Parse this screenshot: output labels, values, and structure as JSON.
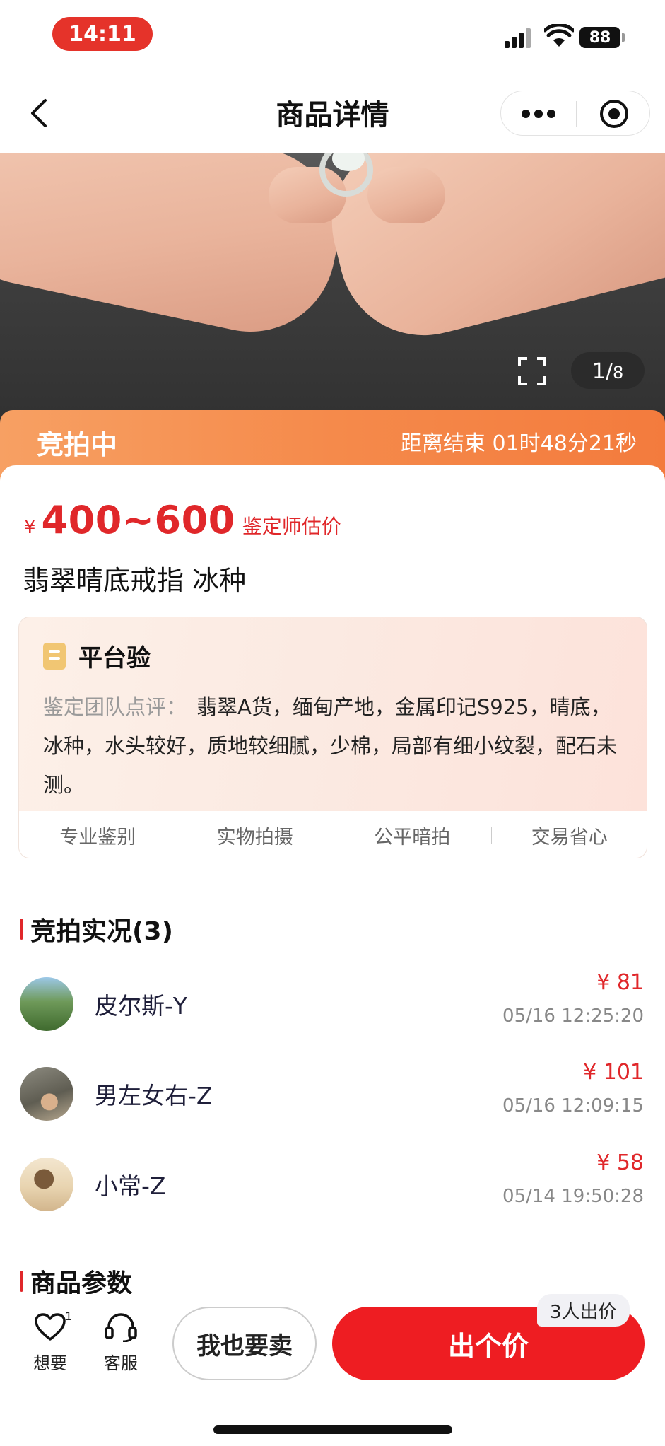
{
  "status_bar": {
    "time": "14:11",
    "battery": "88"
  },
  "nav": {
    "title": "商品详情"
  },
  "gallery": {
    "page_current": "1/",
    "page_total": "8"
  },
  "auction": {
    "status": "竞拍中",
    "countdown": "距离结束 01时48分21秒"
  },
  "product": {
    "price_currency": "¥",
    "price_range": "400~600",
    "price_note": "鉴定师估价",
    "title": "翡翠晴底戒指 冰种"
  },
  "verification": {
    "title": "平台验",
    "review_label": "鉴定团队点评：",
    "review_text": "翡翠A货，缅甸产地，金属印记S925，晴底，冰种，水头较好，质地较细腻，少棉，局部有细小纹裂，配石未测。",
    "features": [
      "专业鉴别",
      "实物拍摄",
      "公平暗拍",
      "交易省心"
    ]
  },
  "bids": {
    "title": "竞拍实况(3)",
    "items": [
      {
        "name": "皮尔斯-Y",
        "amount": "¥ 81",
        "time": "05/16 12:25:20"
      },
      {
        "name": "男左女右-Z",
        "amount": "¥ 101",
        "time": "05/16 12:09:15"
      },
      {
        "name": "小常-Z",
        "amount": "¥ 58",
        "time": "05/14 19:50:28"
      }
    ]
  },
  "params": {
    "title": "商品参数"
  },
  "bottom": {
    "want_label": "想要",
    "want_count": "1",
    "service_label": "客服",
    "sell_label": "我也要卖",
    "bid_label": "出个价",
    "bidders_tag": "3人出价"
  },
  "colors": {
    "accent_red": "#e0272a",
    "banner_orange": "#f58a4b",
    "time_pill": "#e5332a"
  }
}
